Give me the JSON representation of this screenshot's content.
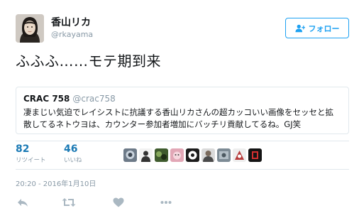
{
  "user": {
    "display_name": "香山リカ",
    "handle": "@rkayama",
    "avatar_icon": "user-avatar-photo"
  },
  "follow_button": {
    "label": "フォロー",
    "icon": "add-user-icon",
    "color": "#1da1f2"
  },
  "tweet": {
    "text": "ふふふ……モテ期到来"
  },
  "quote": {
    "name": "CRAC 758",
    "handle": "@crac758",
    "text": "凄まじい気迫でレイシストに抗議する香山リカさんの超カッコいい画像をセッセと拡散してるネトウヨは、カウンター参加者増加にバッチリ貢献してるね。GJ笑"
  },
  "stats": {
    "retweets": {
      "count": "82",
      "label": "リツイート"
    },
    "likes": {
      "count": "46",
      "label": "いいね"
    },
    "liker_avatars": [
      "avatar-1",
      "avatar-2",
      "avatar-3",
      "avatar-4",
      "avatar-5",
      "avatar-6",
      "avatar-7",
      "avatar-8",
      "avatar-9"
    ]
  },
  "timestamp": "20:20 - 2016年1月10日",
  "actions": [
    "reply-icon",
    "retweet-icon",
    "like-icon",
    "more-icon"
  ],
  "colors": {
    "link_blue": "#1b7ab5",
    "muted": "#8899a6",
    "border": "#e1e8ed"
  }
}
